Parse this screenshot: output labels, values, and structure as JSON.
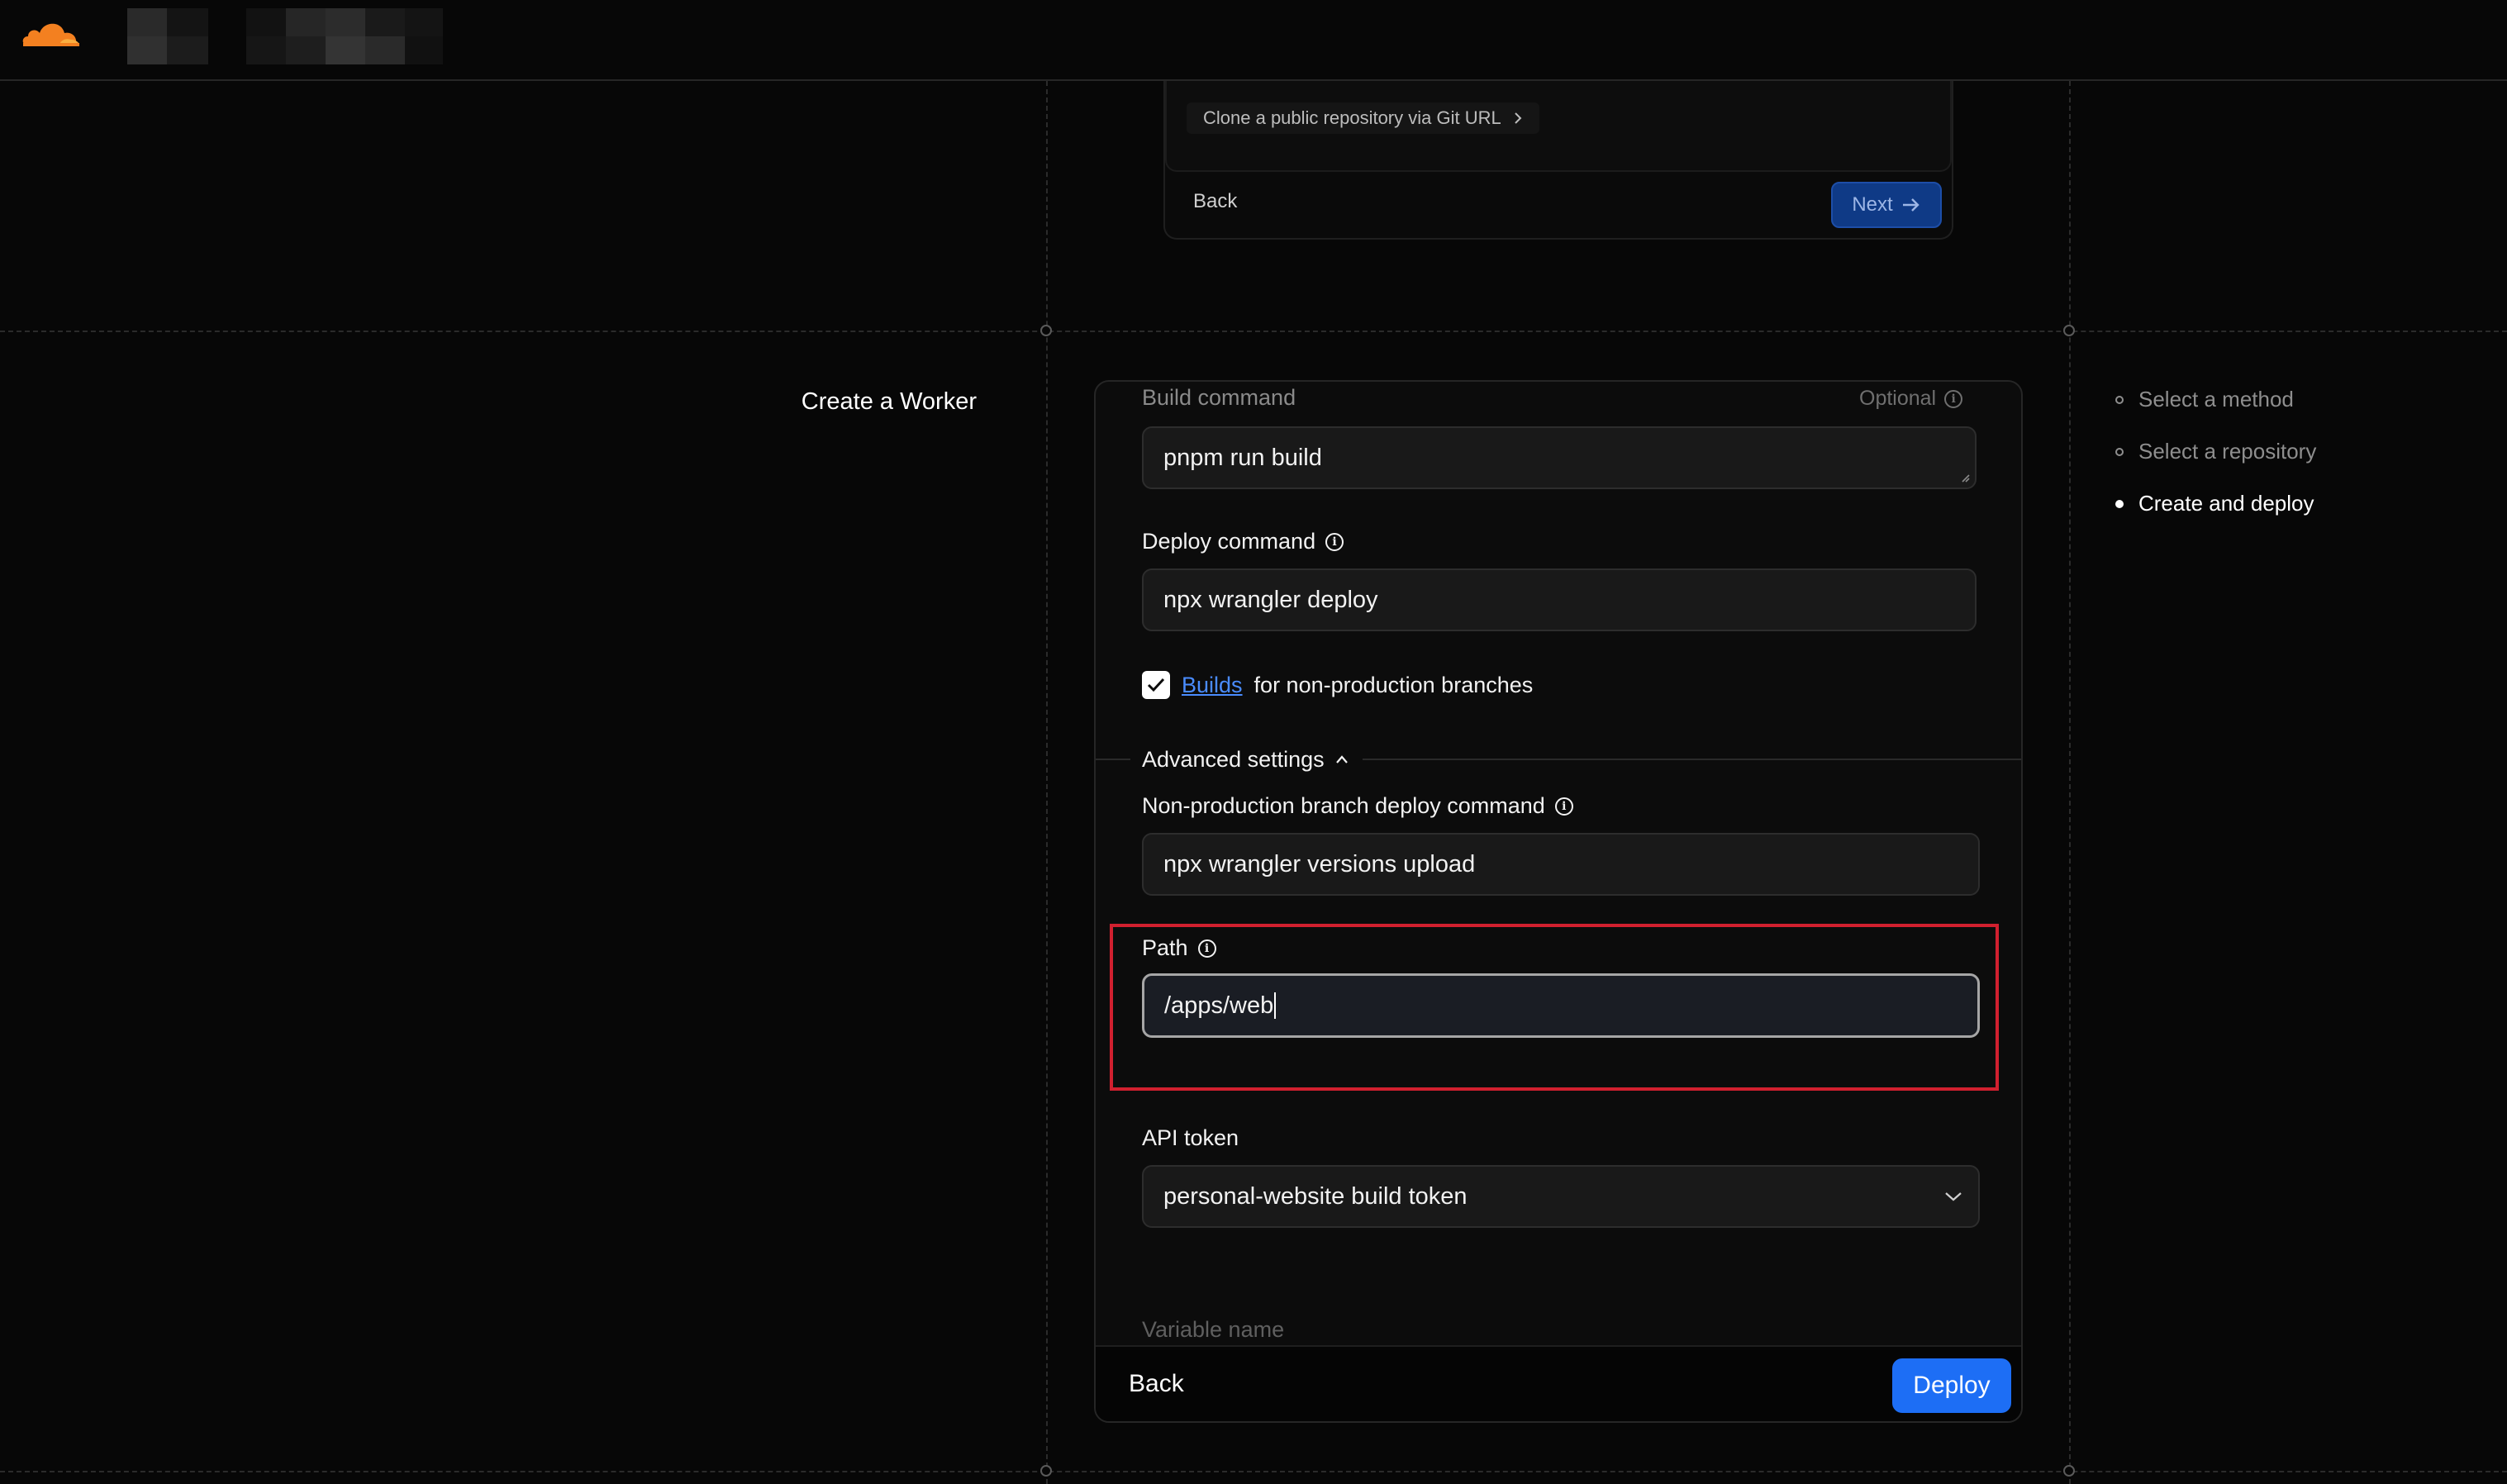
{
  "colors": {
    "background": "#070707",
    "accent": "#1d6ef5",
    "link": "#4a8cff",
    "highlight": "#d1202f",
    "brand_orange": "#f38020"
  },
  "header": {
    "logo_icon": "cloudflare-logo-icon"
  },
  "previous_step": {
    "clone_link": "Clone a public repository via Git URL",
    "back_label": "Back",
    "next_label": "Next"
  },
  "page_title": "Create a Worker",
  "steps": [
    {
      "label": "Select a method",
      "state": "done"
    },
    {
      "label": "Select a repository",
      "state": "done"
    },
    {
      "label": "Create and deploy",
      "state": "active"
    }
  ],
  "form": {
    "build_command": {
      "label": "Build command",
      "optional": "Optional",
      "value": "pnpm run build"
    },
    "deploy_command": {
      "label": "Deploy command",
      "value": "npx wrangler deploy"
    },
    "builds_checkbox": {
      "link": "Builds",
      "text": "for non-production branches",
      "checked": true
    },
    "advanced_settings": {
      "label": "Advanced settings",
      "expanded": true
    },
    "non_prod_deploy": {
      "label": "Non-production branch deploy command",
      "value": "npx wrangler versions upload"
    },
    "path": {
      "label": "Path",
      "value": "/apps/web"
    },
    "api_token": {
      "label": "API token",
      "value": "personal-website build token"
    },
    "variable_name": {
      "label": "Variable name"
    }
  },
  "footer": {
    "back_label": "Back",
    "deploy_label": "Deploy"
  }
}
